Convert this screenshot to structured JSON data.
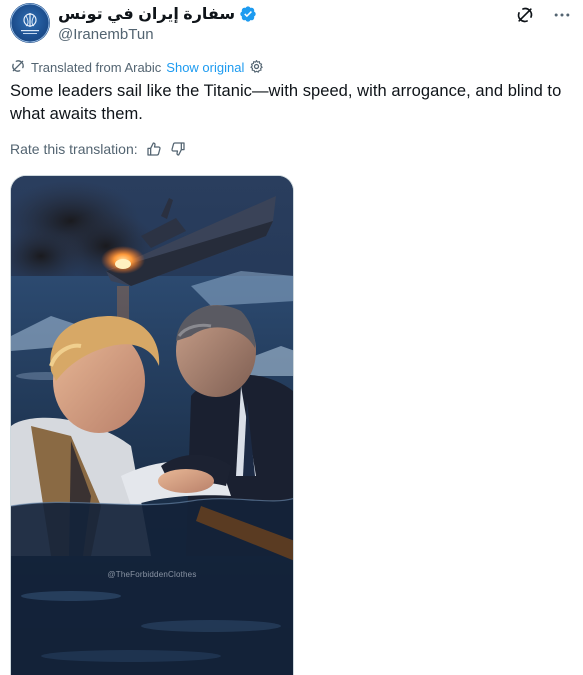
{
  "account": {
    "display_name": "سفارة إيران في تونس",
    "handle": "@IranembTun",
    "verified_color": "#1d9bf0"
  },
  "translation": {
    "label": "Translated from Arabic",
    "show_original": "Show original"
  },
  "tweet": {
    "text": "Some leaders sail like the Titanic—with speed, with arrogance, and blind to what awaits them."
  },
  "rate": {
    "label": "Rate this translation:"
  },
  "media": {
    "watermark": "@TheForbiddenClothes"
  },
  "colors": {
    "accent": "#1d9bf0",
    "secondary_text": "#536471",
    "primary_text": "#0f1419"
  },
  "icons": {
    "header_right_1": "grok-icon",
    "header_right_2": "more-icon",
    "translate": "translate-icon",
    "settings": "gear-icon",
    "like": "thumbs-up-icon",
    "dislike": "thumbs-down-icon"
  }
}
